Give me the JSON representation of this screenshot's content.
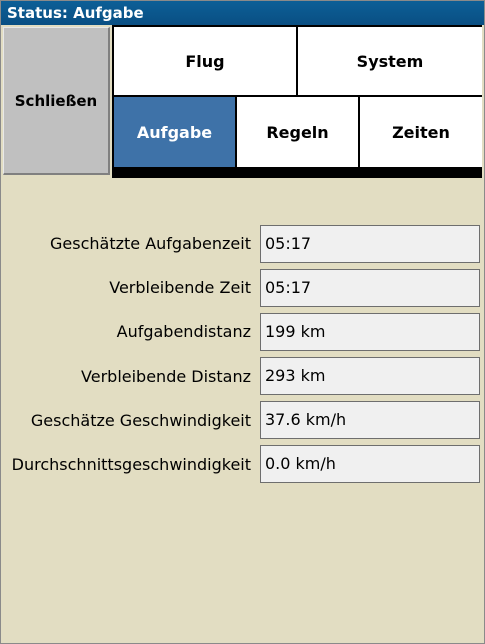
{
  "window": {
    "title": "Status: Aufgabe"
  },
  "close_label": "Schließen",
  "tabs": [
    {
      "label": "Flug"
    },
    {
      "label": "System"
    },
    {
      "label": "Aufgabe",
      "active": true
    },
    {
      "label": "Regeln"
    },
    {
      "label": "Zeiten"
    }
  ],
  "rows": [
    {
      "label": "Geschätzte Aufgabenzeit",
      "value": "05:17"
    },
    {
      "label": "Verbleibende Zeit",
      "value": "05:17"
    },
    {
      "label": "Aufgabendistanz",
      "value": "199 km"
    },
    {
      "label": "Verbleibende Distanz",
      "value": "293 km"
    },
    {
      "label": "Geschätze Geschwindigkeit",
      "value": "37.6 km/h"
    },
    {
      "label": "Durchschnittsgeschwindigkeit",
      "value": "0.0 km/h"
    }
  ],
  "colors": {
    "titlebar": "#0a4f83",
    "active_tab": "#3e72a8",
    "background": "#e2ddc2"
  }
}
